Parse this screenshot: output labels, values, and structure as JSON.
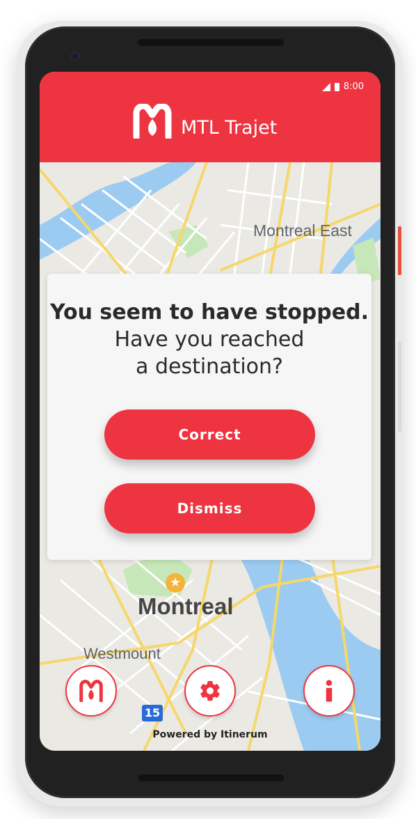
{
  "status_bar": {
    "time": "8:00"
  },
  "app": {
    "title": "MTL Trajet"
  },
  "map": {
    "labels": [
      "Montreal East",
      "Montreal",
      "Westmount"
    ],
    "highway_shield": "15"
  },
  "dialog": {
    "line1": "You seem to have stopped.",
    "line2": "Have you reached",
    "line3": "a destination?",
    "correct_label": "Correct",
    "dismiss_label": "Dismiss"
  },
  "footer": {
    "powered_by": "Powered by Itinerum"
  },
  "bottom_buttons": [
    {
      "icon": "mtl-logo-icon"
    },
    {
      "icon": "gear-icon"
    },
    {
      "icon": "info-icon"
    }
  ],
  "colors": {
    "accent": "#ee3440",
    "water": "#9ccbf1",
    "park": "#c6e7b8",
    "road_major": "#f6d76a"
  }
}
